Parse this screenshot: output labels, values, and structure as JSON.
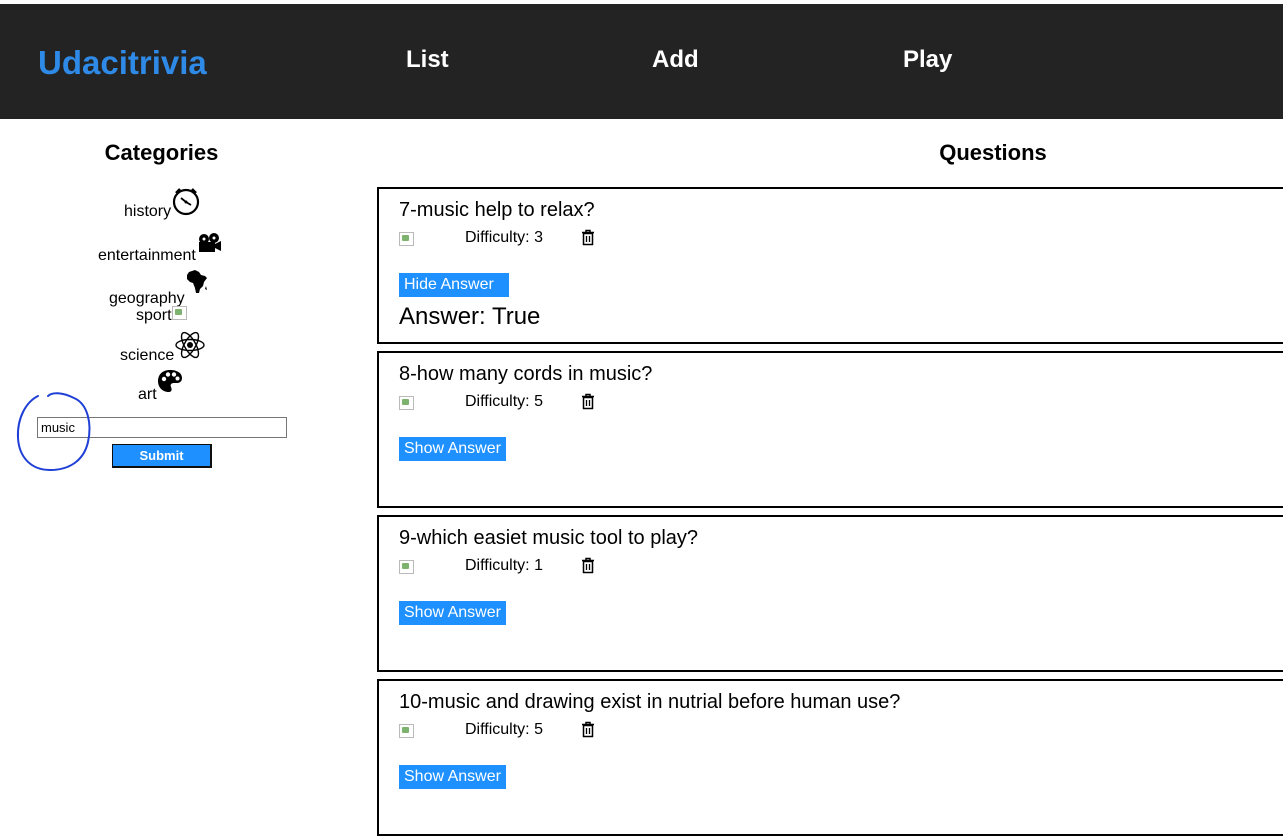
{
  "header": {
    "brand": "Udacitrivia",
    "nav": {
      "list": "List",
      "add": "Add",
      "play": "Play"
    }
  },
  "categories": {
    "title": "Categories",
    "items": [
      {
        "label": "history",
        "icon": "clock-icon"
      },
      {
        "label": "entertainment",
        "icon": "film-projector-icon"
      },
      {
        "label": "geography",
        "icon": "africa-map-icon"
      },
      {
        "label": "sport",
        "icon": "broken-image-icon"
      },
      {
        "label": "science",
        "icon": "atom-icon"
      },
      {
        "label": "art",
        "icon": "palette-icon"
      }
    ],
    "search": {
      "value": "music",
      "submit_label": "Submit"
    },
    "annotation_color": "#1f3fd6"
  },
  "questions": {
    "title": "Questions",
    "difficulty_label": "Difficulty:",
    "items": [
      {
        "text": "7-music help to relax?",
        "difficulty": "3",
        "button_label": "Hide Answer",
        "answer_prefix": "Answer:",
        "answer": "True"
      },
      {
        "text": "8-how many cords in music?",
        "difficulty": "5",
        "button_label": "Show Answer"
      },
      {
        "text": "9-which easiet music tool to play?",
        "difficulty": "1",
        "button_label": "Show Answer"
      },
      {
        "text": "10-music and drawing exist in nutrial before human use?",
        "difficulty": "5",
        "button_label": "Show Answer"
      }
    ]
  },
  "colors": {
    "header_bg": "#232323",
    "brand": "#2e8ae6",
    "accent_button": "#1e90ff"
  }
}
